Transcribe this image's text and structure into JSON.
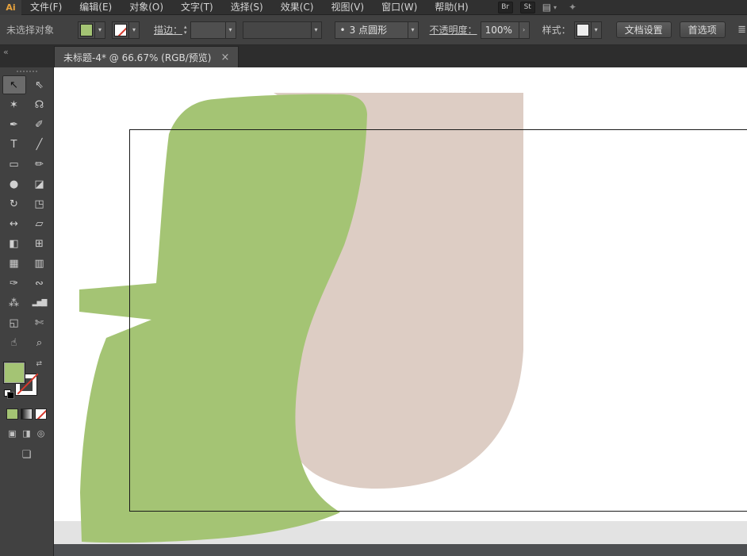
{
  "colors": {
    "green_fill": "#a4c474",
    "beige_fill": "#ddcdc4",
    "rect_stroke": "#1a1a1a",
    "pasteboard_gray": "#e3e3e3",
    "bottom_strip": "#4d4f52",
    "logo_orange": "#e8a33d",
    "slash_red": "#d6382c"
  },
  "menubar": {
    "logo": "Ai",
    "items": [
      {
        "label": "文件(F)"
      },
      {
        "label": "编辑(E)"
      },
      {
        "label": "对象(O)"
      },
      {
        "label": "文字(T)"
      },
      {
        "label": "选择(S)"
      },
      {
        "label": "效果(C)"
      },
      {
        "label": "视图(V)"
      },
      {
        "label": "窗口(W)"
      },
      {
        "label": "帮助(H)"
      }
    ],
    "br_label": "Br",
    "st_label": "St"
  },
  "controlbar": {
    "status": "未选择对象",
    "stroke_label": "描边：",
    "brush_bullet": "•",
    "brush_value": "3 点圆形",
    "opacity_label": "不透明度：",
    "opacity_value": "100%",
    "style_label": "样式：",
    "document_setup": "文档设置",
    "preferences": "首选项"
  },
  "tabbar": {
    "title": "未标题-4* @ 66.67% (RGB/预览)"
  },
  "icons": {
    "caret_down": "▾",
    "caret_right": "›",
    "spin_up": "▴",
    "spin_down": "▾",
    "collapse": "«",
    "close": "×",
    "swap": "⇄",
    "workspace": "▤",
    "share": "✦",
    "panel_clip": "≣",
    "draw_normal": "▣",
    "draw_behind": "◨",
    "draw_inside": "◎",
    "screen_mode": "❏"
  },
  "toolbar": {
    "tools": [
      {
        "name": "selection",
        "glyph": "↖",
        "active": true
      },
      {
        "name": "direct-selection",
        "glyph": "⇖"
      },
      {
        "name": "magic-wand",
        "glyph": "✶"
      },
      {
        "name": "lasso",
        "glyph": "☊"
      },
      {
        "name": "pen",
        "glyph": "✒"
      },
      {
        "name": "paintbrush",
        "glyph": "✐"
      },
      {
        "name": "type",
        "glyph": "T"
      },
      {
        "name": "line-segment",
        "glyph": "╱"
      },
      {
        "name": "rectangle",
        "glyph": "▭"
      },
      {
        "name": "pencil",
        "glyph": "✏"
      },
      {
        "name": "blob-brush",
        "glyph": "●"
      },
      {
        "name": "eraser",
        "glyph": "◪"
      },
      {
        "name": "rotate",
        "glyph": "↻"
      },
      {
        "name": "scale",
        "glyph": "◳"
      },
      {
        "name": "width",
        "glyph": "↔"
      },
      {
        "name": "free-transform",
        "glyph": "▱"
      },
      {
        "name": "shape-builder",
        "glyph": "◧"
      },
      {
        "name": "perspective-grid",
        "glyph": "⊞"
      },
      {
        "name": "mesh",
        "glyph": "▦"
      },
      {
        "name": "gradient",
        "glyph": "▥"
      },
      {
        "name": "eyedropper",
        "glyph": "✑"
      },
      {
        "name": "blend",
        "glyph": "∾"
      },
      {
        "name": "symbol-sprayer",
        "glyph": "⁂"
      },
      {
        "name": "column-graph",
        "glyph": "▂▅▇"
      },
      {
        "name": "artboard",
        "glyph": "◱"
      },
      {
        "name": "slice",
        "glyph": "✄"
      },
      {
        "name": "hand",
        "glyph": "☝"
      },
      {
        "name": "zoom",
        "glyph": "⌕"
      }
    ]
  }
}
